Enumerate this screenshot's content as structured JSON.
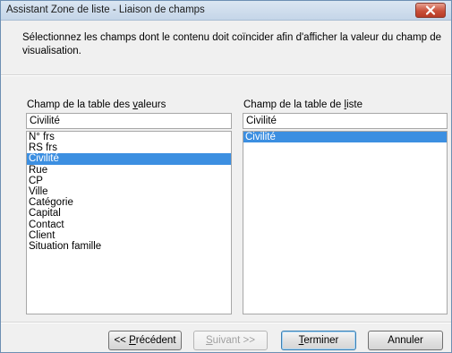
{
  "window": {
    "title": "Assistant Zone de liste - Liaison de champs"
  },
  "intro_text": "Sélectionnez les champs dont le contenu doit coïncider afin d'afficher la valeur du champ de visualisation.",
  "left": {
    "label_pre": "Champ de la table des ",
    "label_u": "v",
    "label_post": "aleurs",
    "field_value": "Civilité",
    "items": [
      "N° frs",
      "RS frs",
      "Civilité",
      "Rue",
      "CP",
      "Ville",
      "Catégorie",
      "Capital",
      "Contact",
      "Client",
      "Situation famille"
    ],
    "selected": "Civilité"
  },
  "right": {
    "label_pre": "Champ de la table de ",
    "label_u": "l",
    "label_post": "iste",
    "field_value": "Civilité",
    "items": [
      "Civilité"
    ],
    "selected": "Civilité"
  },
  "buttons": {
    "previous_pre": "<< ",
    "previous_u": "P",
    "previous_post": "récédent",
    "next_u": "S",
    "next_post": "uivant >>",
    "finish_u": "T",
    "finish_post": "erminer",
    "cancel": "Annuler"
  },
  "colors": {
    "selection": "#3c8fe1",
    "close_button": "#c9503a"
  },
  "icons": {
    "close": "close-icon"
  }
}
